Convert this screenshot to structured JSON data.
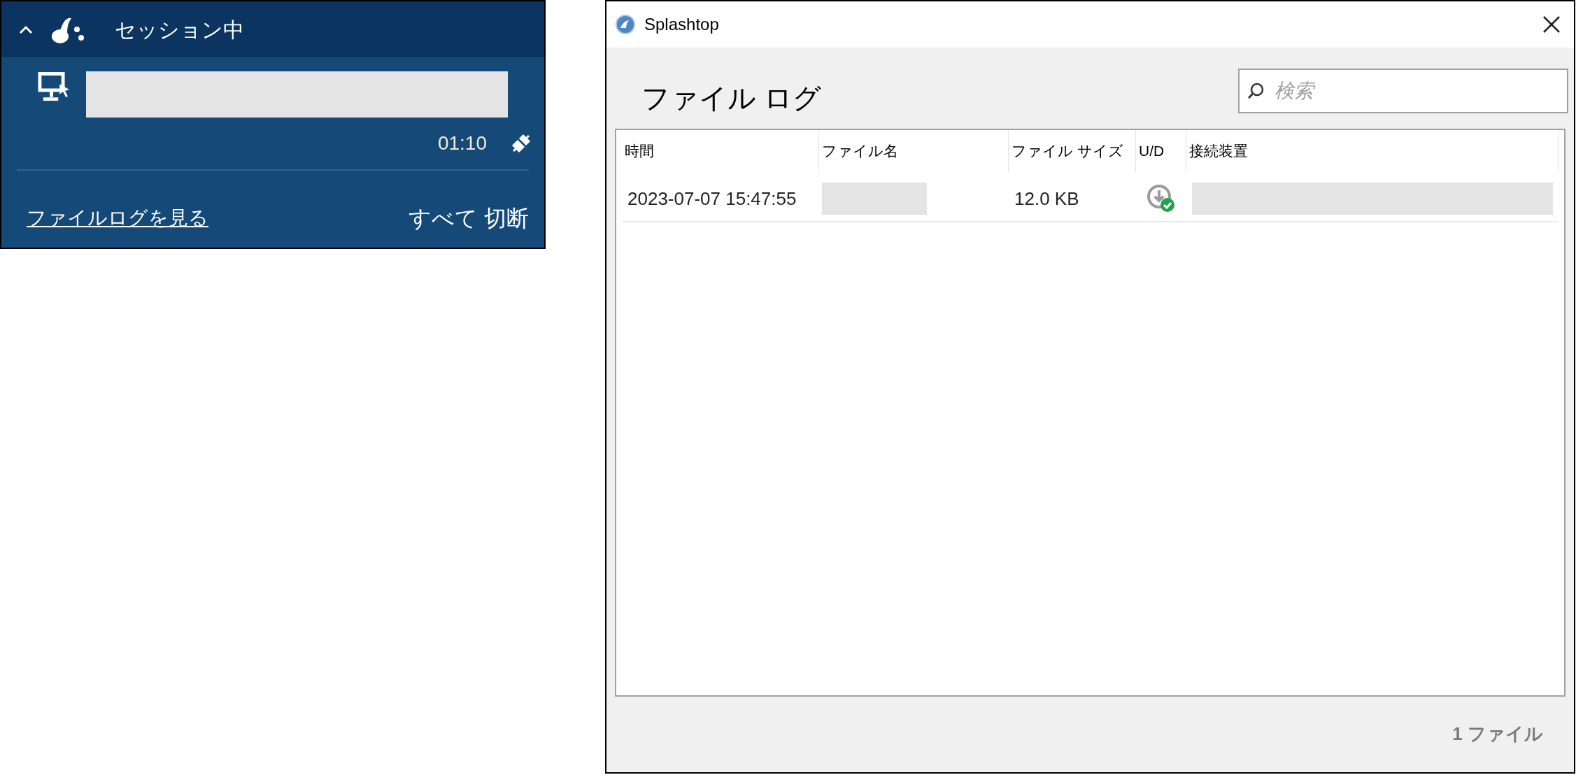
{
  "session_panel": {
    "expanded": true,
    "title": "セッション中",
    "session": {
      "time": "01:10"
    },
    "file_log_link": "ファイルログを見る",
    "disconnect_all": "すべて 切断"
  },
  "window": {
    "title": "Splashtop",
    "heading": "ファイル ログ",
    "search": {
      "placeholder": "検索"
    },
    "table": {
      "columns": [
        "時間",
        "ファイル名",
        "ファイル サイズ",
        "U/D",
        "接続装置"
      ],
      "rows": [
        {
          "time": "2023-07-07 15:47:55",
          "size": "12.0 KB",
          "kind": "download",
          "done": true
        }
      ]
    },
    "status_bar": "1 ファイル"
  }
}
